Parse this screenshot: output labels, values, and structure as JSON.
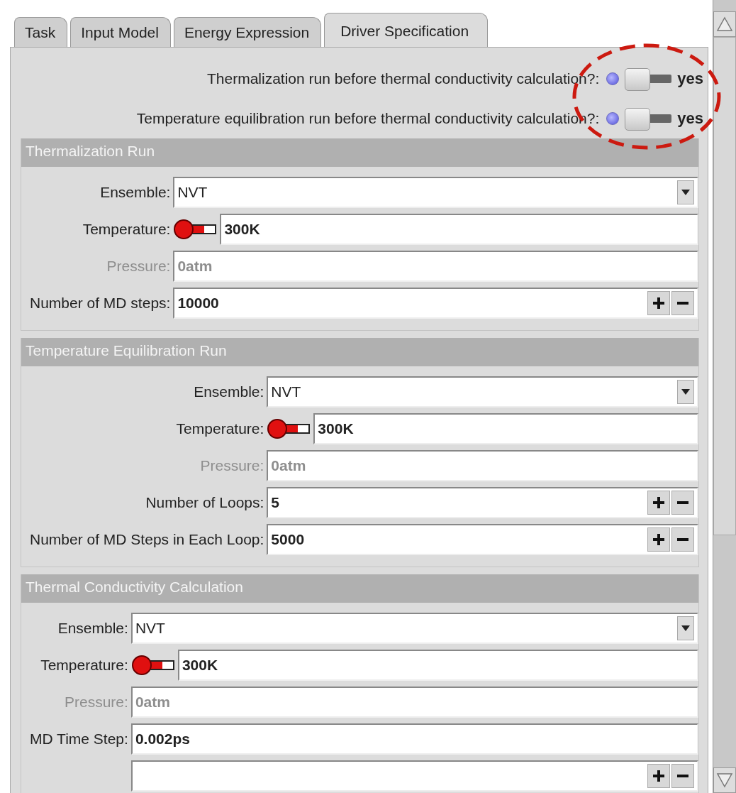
{
  "tabs": [
    {
      "label": "Task",
      "selected": false
    },
    {
      "label": "Input Model",
      "selected": false
    },
    {
      "label": "Energy Expression",
      "selected": false
    },
    {
      "label": "Driver Specification",
      "selected": true
    }
  ],
  "toggles": [
    {
      "label": "Thermalization run before thermal conductivity calculation?:",
      "on": true,
      "state_text": "yes"
    },
    {
      "label": "Temperature equilibration run before thermal conductivity calculation?:",
      "on": true,
      "state_text": "yes"
    }
  ],
  "sections": [
    {
      "title": "Thermalization Run",
      "rows": [
        {
          "kind": "select",
          "label": "Ensemble:",
          "value": "NVT"
        },
        {
          "kind": "temperature",
          "label": "Temperature:",
          "value": "300K"
        },
        {
          "kind": "text",
          "label": "Pressure:",
          "value": "0atm",
          "disabled": true
        },
        {
          "kind": "spin",
          "label": "Number of MD steps:",
          "value": "10000"
        }
      ]
    },
    {
      "title": "Temperature Equilibration Run",
      "rows": [
        {
          "kind": "select",
          "label": "Ensemble:",
          "value": "NVT"
        },
        {
          "kind": "temperature",
          "label": "Temperature:",
          "value": "300K"
        },
        {
          "kind": "text",
          "label": "Pressure:",
          "value": "0atm",
          "disabled": true
        },
        {
          "kind": "spin",
          "label": "Number of Loops:",
          "value": "5"
        },
        {
          "kind": "spin",
          "label": "Number of MD Steps in Each Loop:",
          "value": "5000"
        }
      ]
    },
    {
      "title": "Thermal Conductivity Calculation",
      "rows": [
        {
          "kind": "select",
          "label": "Ensemble:",
          "value": "NVT"
        },
        {
          "kind": "temperature",
          "label": "Temperature:",
          "value": "300K"
        },
        {
          "kind": "text",
          "label": "Pressure:",
          "value": "0atm",
          "disabled": true
        },
        {
          "kind": "text",
          "label": "MD Time Step:",
          "value": "0.002ps",
          "disabled": false
        },
        {
          "kind": "spin"
        }
      ]
    }
  ]
}
